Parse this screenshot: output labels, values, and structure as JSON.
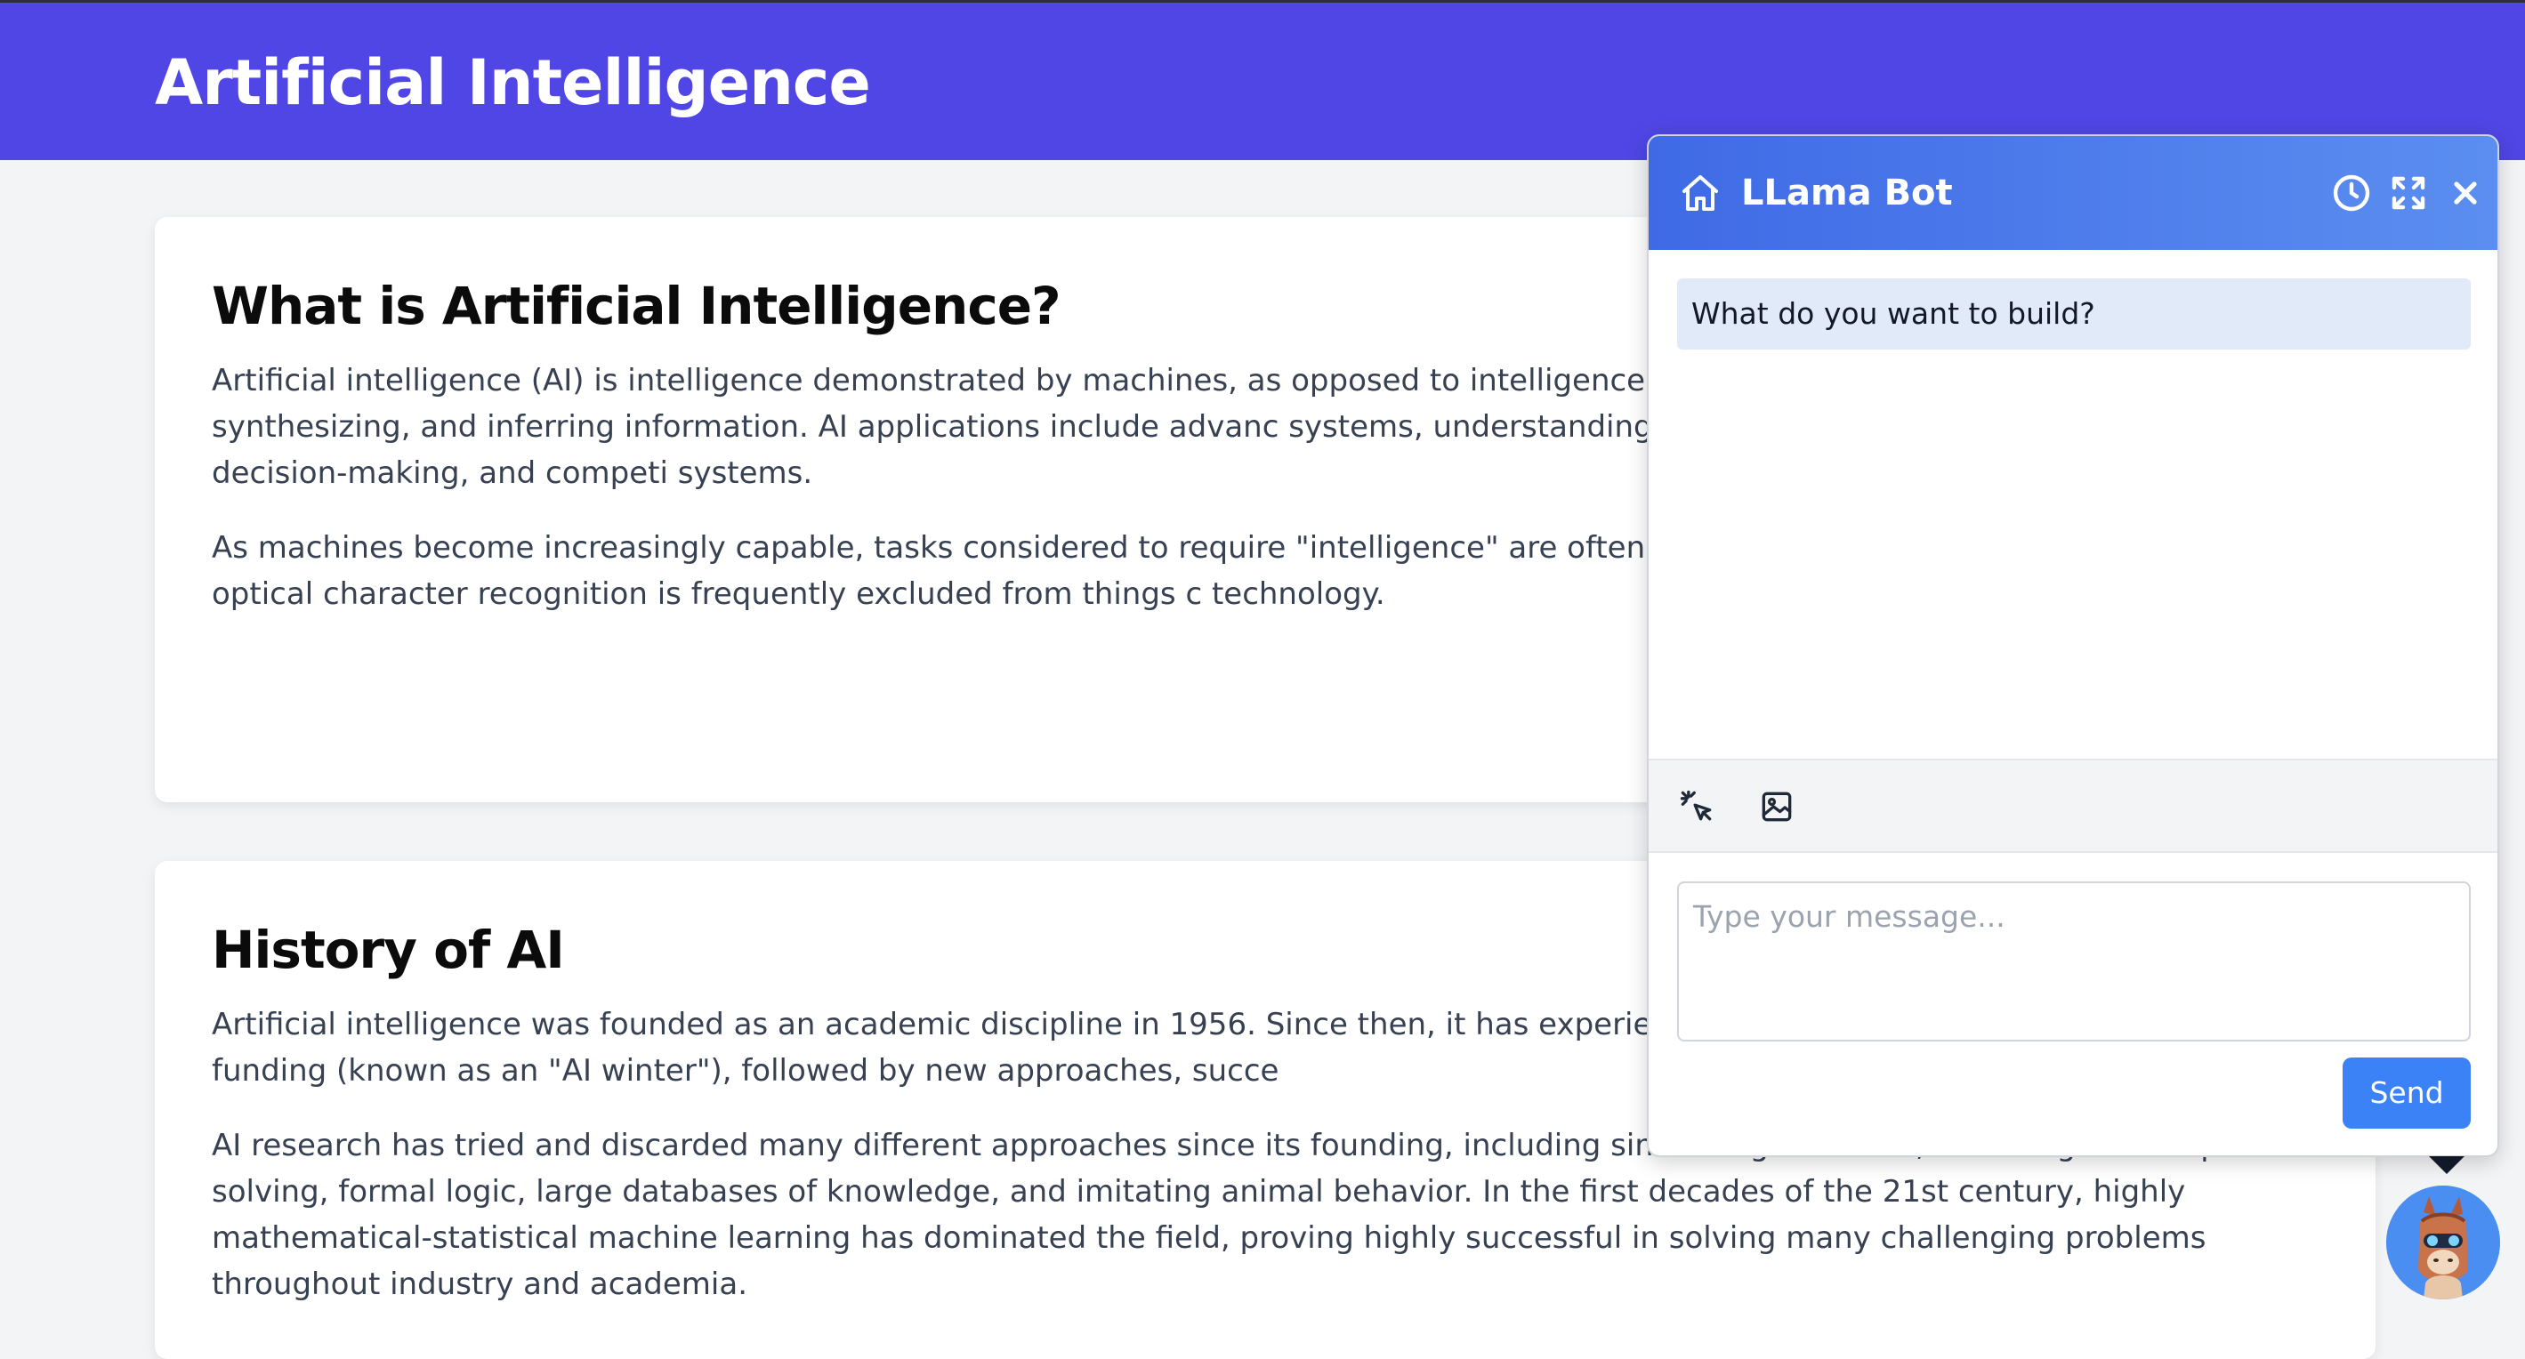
{
  "header": {
    "title": "Artificial Intelligence",
    "background_color": "#4f46e5"
  },
  "sections": [
    {
      "heading": "What is Artificial Intelligence?",
      "paragraphs": [
        "Artificial intelligence (AI) is intelligence demonstrated by machines, as opposed to intelligence displa involves machines perceiving, synthesizing, and inferring information. AI applications include advanc systems, understanding human speech, self-driving cars, automated decision-making, and competi systems.",
        "As machines become increasingly capable, tasks considered to require \"intelligence\" are often remov known as the AI effect. For instance, optical character recognition is frequently excluded from things c technology."
      ]
    },
    {
      "heading": "History of AI",
      "paragraphs": [
        "Artificial intelligence was founded as an academic discipline in 1956. Since then, it has experienced se disappointment and the loss of funding (known as an \"AI winter\"), followed by new approaches, succe",
        "AI research has tried and discarded many different approaches since its founding, including simulating the brain, modeling human problem solving, formal logic, large databases of knowledge, and imitating animal behavior. In the first decades of the 21st century, highly mathematical-statistical machine learning has dominated the field, proving highly successful in solving many challenging problems throughout industry and academia."
      ]
    }
  ],
  "chat": {
    "title": "LLama Bot",
    "header_gradient": [
      "#3f6ae6",
      "#5b8ef0"
    ],
    "header_icons": [
      "home-icon",
      "clock-icon",
      "expand-icon",
      "close-icon"
    ],
    "messages": [
      {
        "role": "bot",
        "text": "What do you want to build?"
      }
    ],
    "toolbar_icons": [
      "sparkle-cursor-icon",
      "image-icon"
    ],
    "input": {
      "value": "",
      "placeholder": "Type your message..."
    },
    "send_label": "Send",
    "accent_color": "#3b82f6",
    "launcher_icon": "llama-avatar-icon"
  }
}
